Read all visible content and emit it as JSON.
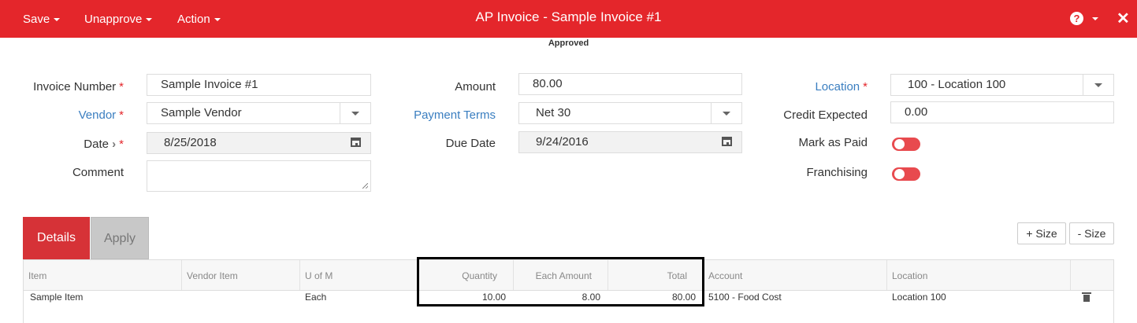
{
  "header": {
    "menus": [
      {
        "label": "Save"
      },
      {
        "label": "Unapprove"
      },
      {
        "label": "Action"
      }
    ],
    "title": "AP Invoice - Sample Invoice #1",
    "help_icon": "question-circle-icon",
    "close_icon": "close-icon",
    "status": "Approved"
  },
  "form": {
    "invoice_number": {
      "label": "Invoice Number",
      "value": "Sample Invoice #1"
    },
    "vendor": {
      "label": "Vendor",
      "value": "Sample Vendor"
    },
    "date": {
      "label": "Date",
      "value": "8/25/2018"
    },
    "comment": {
      "label": "Comment",
      "value": ""
    },
    "amount": {
      "label": "Amount",
      "value": "80.00"
    },
    "payment_terms": {
      "label": "Payment Terms",
      "value": "Net 30"
    },
    "due_date": {
      "label": "Due Date",
      "value": "9/24/2016"
    },
    "location": {
      "label": "Location",
      "value": "100 - Location 100"
    },
    "credit_expected": {
      "label": "Credit Expected",
      "value": "0.00"
    },
    "mark_as_paid": {
      "label": "Mark as Paid",
      "on": false
    },
    "franchising": {
      "label": "Franchising",
      "on": false
    },
    "required_mark": "*",
    "date_chevron": "›"
  },
  "tabs": [
    {
      "label": "Details",
      "active": true
    },
    {
      "label": "Apply",
      "active": false
    }
  ],
  "size_buttons": {
    "increase": "+ Size",
    "decrease": "- Size"
  },
  "grid": {
    "columns": [
      "Item",
      "Vendor Item",
      "U of M",
      "Quantity",
      "Each Amount",
      "Total",
      "Account",
      "Location"
    ],
    "rows": [
      {
        "item": "Sample Item",
        "vendor_item": "",
        "uom": "Each",
        "quantity": "10.00",
        "each_amount": "8.00",
        "total": "80.00",
        "account": "5100 - Food Cost",
        "location": "Location 100"
      }
    ]
  },
  "colors": {
    "accent": "#e4262b",
    "link": "#3a7ec0",
    "tab_active": "#d63237"
  }
}
